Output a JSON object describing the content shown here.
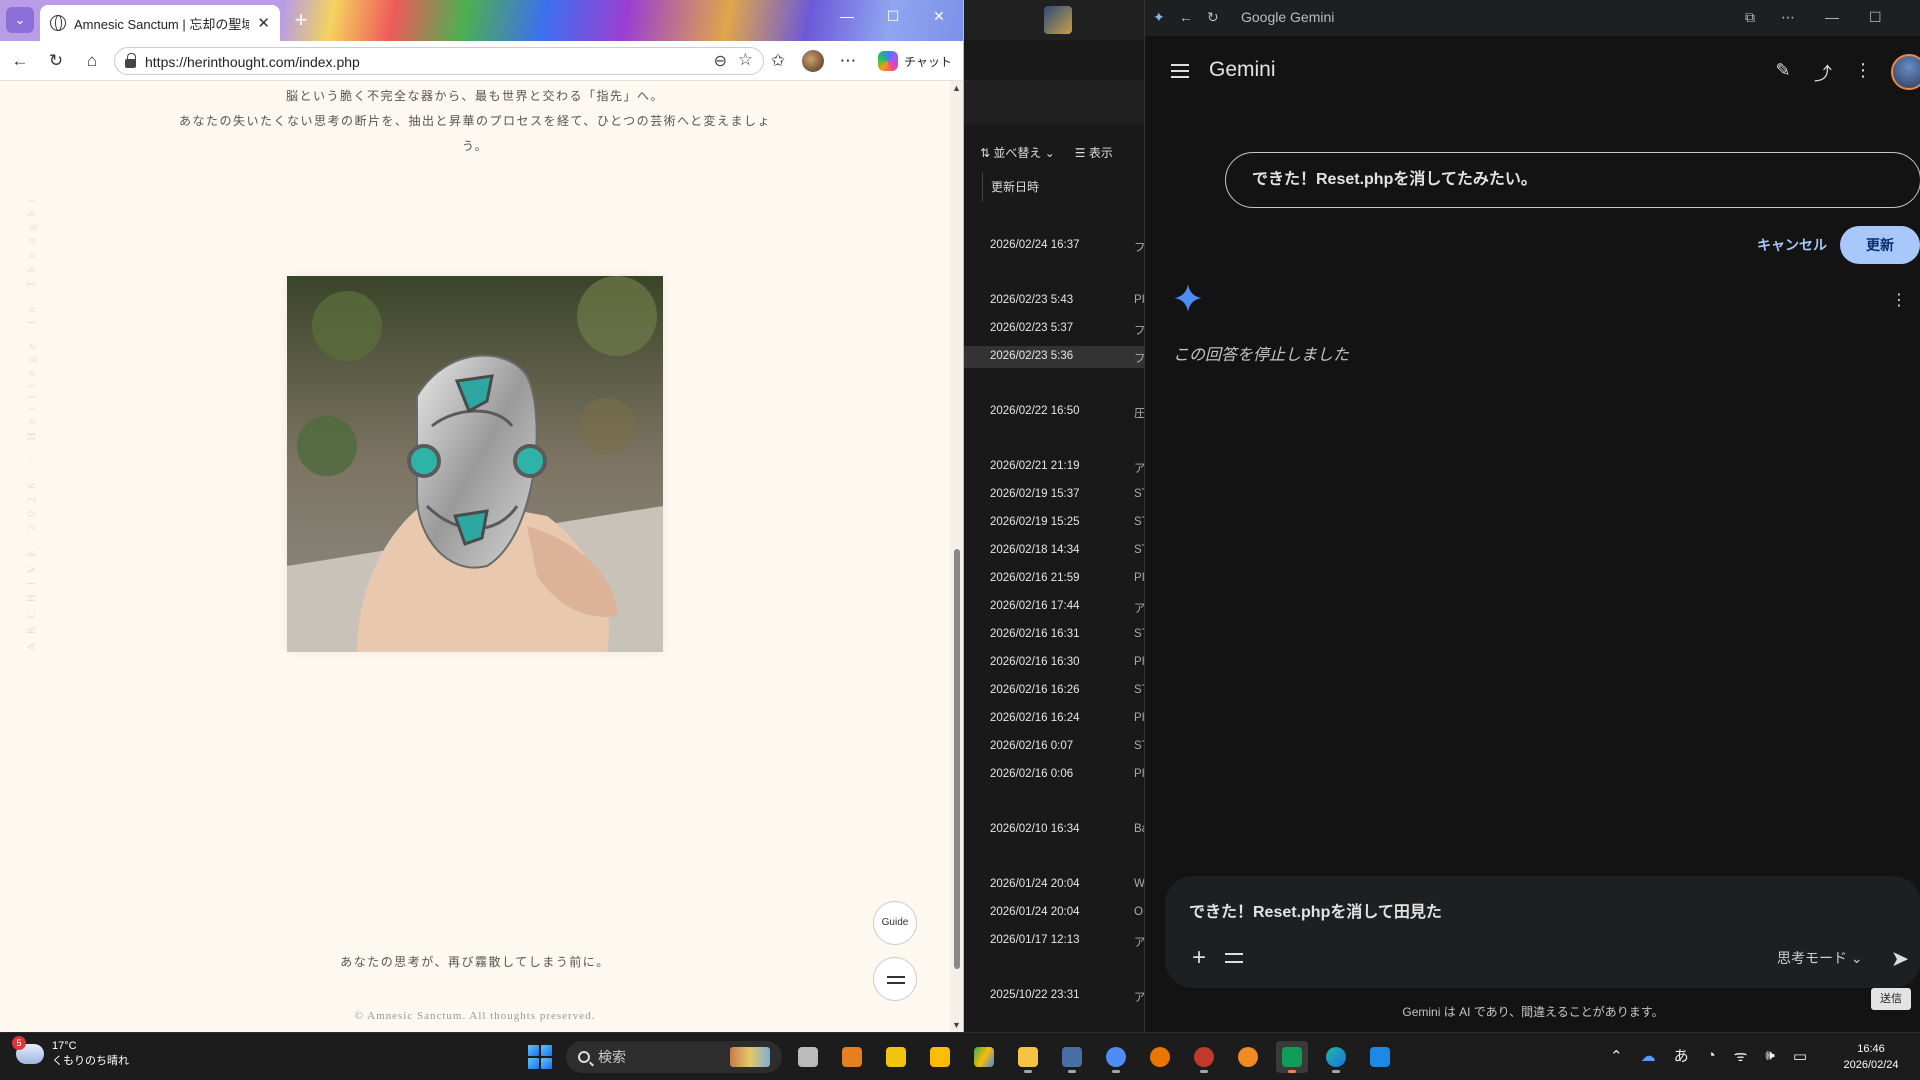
{
  "edge": {
    "tab_title": "Amnesic Sanctum | 忘却の聖域",
    "url": "https://herinthought.com/index.php",
    "chat_label": "チャット",
    "page": {
      "side_text": "ARCHIVE 2026 · Heritage In Thought",
      "intro_line1": "脳という脆く不完全な器から、最も世界と交わる「指先」へ。",
      "intro_line2": "あなたの失いたくない思考の断片を、抽出と昇華のプロセスを経て、ひとつの芸術へと変えましょ",
      "intro_line3": "う。",
      "guide_label": "Guide",
      "footer_tagline": "あなたの思考が、再び霧散してしまう前に。",
      "copyright": "© Amnesic Sanctum. All thoughts preserved."
    }
  },
  "explorer": {
    "sort_label": "並べ替え",
    "view_label": "表示",
    "column_header": "更新日時",
    "rows": [
      {
        "date": "2026/02/24 16:37",
        "type": "フ"
      },
      {
        "date": "2026/02/23 5:43",
        "type": "PI"
      },
      {
        "date": "2026/02/23 5:37",
        "type": "フ"
      },
      {
        "date": "2026/02/23 5:36",
        "type": "フ"
      },
      {
        "date": "2026/02/22 16:50",
        "type": "圧"
      },
      {
        "date": "2026/02/21 21:19",
        "type": "ア"
      },
      {
        "date": "2026/02/19 15:37",
        "type": "ST"
      },
      {
        "date": "2026/02/19 15:25",
        "type": "ST"
      },
      {
        "date": "2026/02/18 14:34",
        "type": "ST"
      },
      {
        "date": "2026/02/16 21:59",
        "type": "PI"
      },
      {
        "date": "2026/02/16 17:44",
        "type": "ア"
      },
      {
        "date": "2026/02/16 16:31",
        "type": "ST"
      },
      {
        "date": "2026/02/16 16:30",
        "type": "PI"
      },
      {
        "date": "2026/02/16 16:26",
        "type": "ST"
      },
      {
        "date": "2026/02/16 16:24",
        "type": "PI"
      },
      {
        "date": "2026/02/16 0:07",
        "type": "ST"
      },
      {
        "date": "2026/02/16 0:06",
        "type": "PI"
      },
      {
        "date": "2026/02/10 16:34",
        "type": "Ba"
      },
      {
        "date": "2026/01/24 20:04",
        "type": "W"
      },
      {
        "date": "2026/01/24 20:04",
        "type": "O"
      },
      {
        "date": "2026/01/17 12:13",
        "type": "ア"
      },
      {
        "date": "2025/10/22 23:31",
        "type": "ア"
      }
    ]
  },
  "gemini": {
    "window_title": "Google Gemini",
    "app_title": "Gemini",
    "edit_prompt": "できた！Reset.phpを消してたみたい。",
    "cancel_label": "キャンセル",
    "update_label": "更新",
    "stopped_message": "この回答を停止しました",
    "input_text": "できた！Reset.phpを消して田見た",
    "mode_label": "思考モード",
    "send_tooltip": "送信",
    "disclaimer": "Gemini は AI であり、間違えることがあります。"
  },
  "taskbar": {
    "weather_badge": "5",
    "temperature": "17°C",
    "weather_text": "くもりのち晴れ",
    "search_label": "検索",
    "ime_label": "あ",
    "time": "16:46",
    "date": "2026/02/24"
  }
}
